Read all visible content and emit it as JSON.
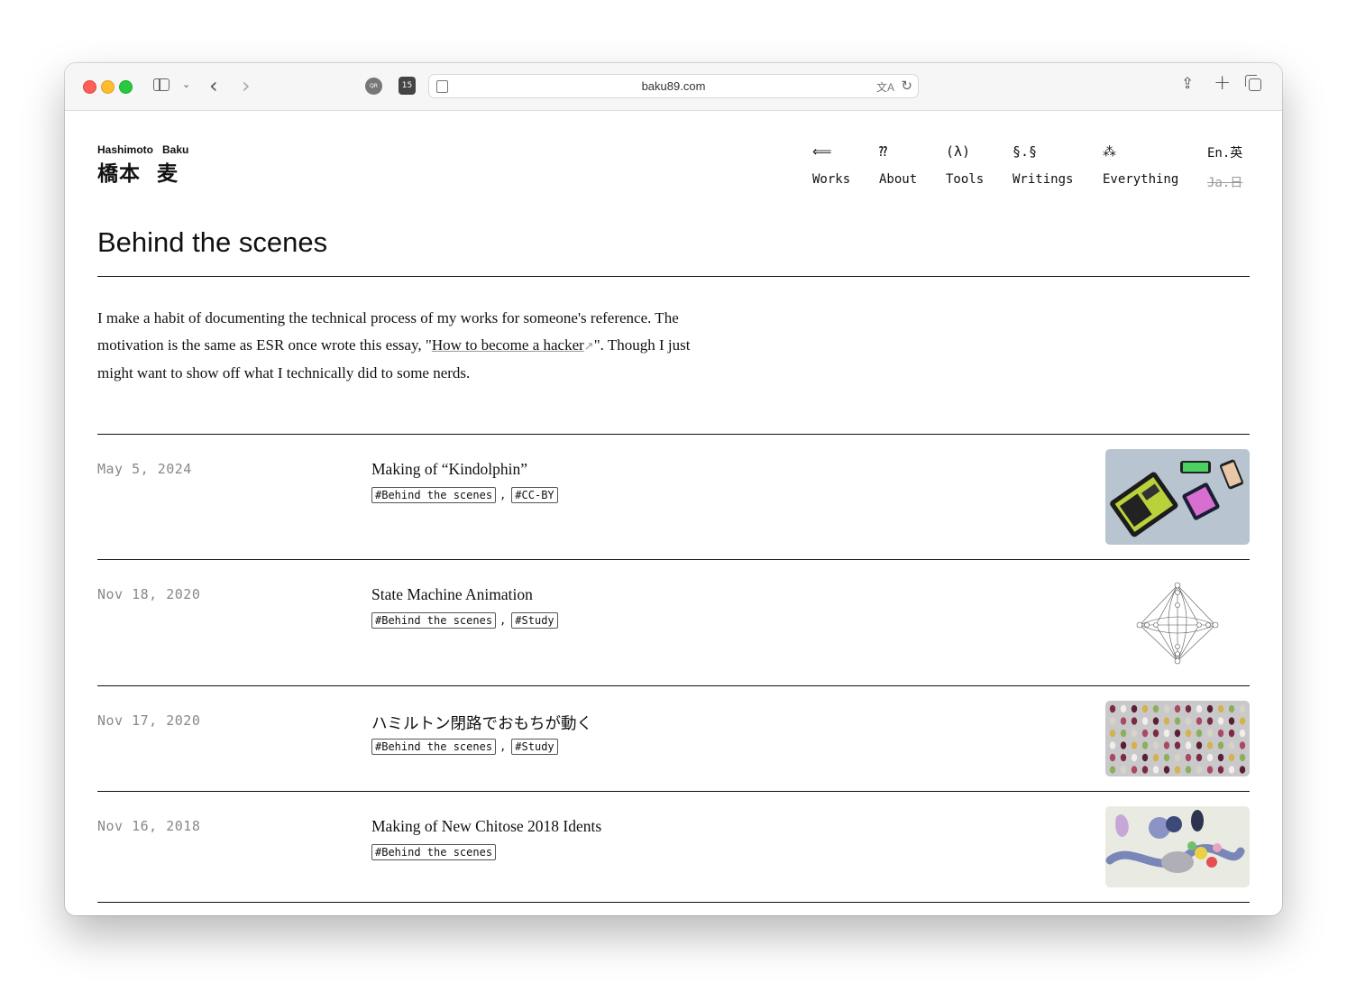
{
  "browser": {
    "url": "baku89.com",
    "ext1_label": "QR",
    "ext2_label": "15"
  },
  "site": {
    "logo_latin": [
      "Hashimoto",
      "Baku"
    ],
    "logo_kanji": [
      "橋本",
      "麦"
    ]
  },
  "nav": [
    {
      "symbol": "⟸",
      "label": "Works"
    },
    {
      "symbol": "⁇",
      "label": "About"
    },
    {
      "symbol": "(λ)",
      "label": "Tools"
    },
    {
      "symbol": "§.§",
      "label": "Writings"
    },
    {
      "symbol": "⁂",
      "label": "Everything"
    }
  ],
  "lang": {
    "en": "En.英",
    "ja": "Ja.日"
  },
  "page": {
    "title": "Behind the scenes",
    "intro_before": "I make a habit of documenting the technical process of my works for someone's reference. The motivation is the same as ESR once wrote this essay, \"",
    "intro_link": "How to become a hacker",
    "intro_after": "\". Though I just might want to show off what I technically did to some nerds."
  },
  "entries": [
    {
      "date": "May 5, 2024",
      "title": "Making of “Kindolphin”",
      "tags": [
        "Behind the scenes",
        "CC-BY"
      ]
    },
    {
      "date": "Nov 18, 2020",
      "title": "State Machine Animation",
      "tags": [
        "Behind the scenes",
        "Study"
      ]
    },
    {
      "date": "Nov 17, 2020",
      "title": "ハミルトン閉路でおもちが動く",
      "tags": [
        "Behind the scenes",
        "Study"
      ]
    },
    {
      "date": "Nov 16, 2018",
      "title": "Making of New Chitose 2018 Idents",
      "tags": [
        "Behind the scenes"
      ]
    }
  ]
}
